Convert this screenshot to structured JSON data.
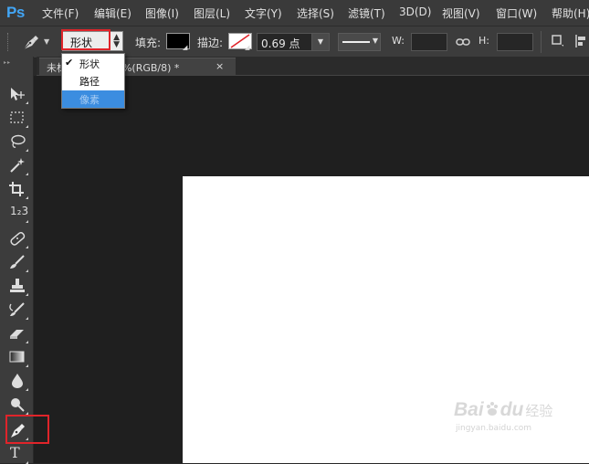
{
  "app": {
    "logo": "Ps"
  },
  "menu": [
    "文件(F)",
    "编辑(E)",
    "图像(I)",
    "图层(L)",
    "文字(Y)",
    "选择(S)",
    "滤镜(T)",
    "3D(D)",
    "视图(V)",
    "窗口(W)",
    "帮助(H)"
  ],
  "options": {
    "mode_value": "形状",
    "fill_label": "填充:",
    "fill_color": "#000000",
    "stroke_label": "描边:",
    "stroke_width": "0.69 点",
    "w_label": "W:",
    "h_label": "H:"
  },
  "mode_dropdown": {
    "items": [
      {
        "check": "✔",
        "label": "形状"
      },
      {
        "check": "",
        "label": "路径"
      },
      {
        "check": "",
        "label": "像素"
      }
    ],
    "selected_index": 2
  },
  "document": {
    "tab_title": "未标题-1 @ 100%(RGB/8) *",
    "close": "×"
  },
  "tools": [
    "move-tool",
    "marquee-tool",
    "lasso-tool",
    "magic-wand-tool",
    "crop-tool",
    "count-tool",
    "healing-brush-tool",
    "brush-tool",
    "clone-stamp-tool",
    "history-brush-tool",
    "eraser-tool",
    "gradient-tool",
    "blur-tool",
    "dodge-tool",
    "pen-tool",
    "type-tool"
  ],
  "type_tool_glyph": "T",
  "count_tool_glyph": "1₂3",
  "colors": {
    "highlight_box": "#e0242a",
    "selection": "#3b8de0",
    "stroke_slash": "#e0242a"
  },
  "watermark": {
    "brand": "Bai",
    "brand_end": "du",
    "cn": "经验",
    "url": "jingyan.baidu.com"
  }
}
